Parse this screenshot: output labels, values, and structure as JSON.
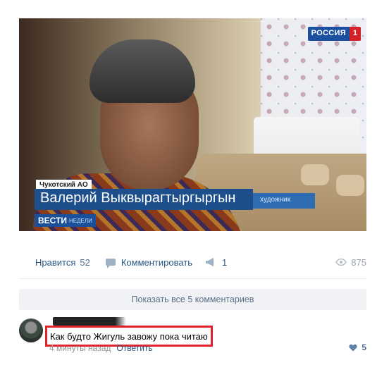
{
  "video": {
    "channel_logo": "РОССИЯ",
    "channel_number": "1",
    "region": "Чукотский АО",
    "person_name": "Валерий Выквырагтыргыргын",
    "person_role": "художник",
    "show_logo": "ВЕСТИ",
    "show_logo_sub": "НЕДЕЛИ"
  },
  "actions": {
    "like_label": "Нравится",
    "like_count": "52",
    "comment_label": "Комментировать",
    "share_count": "1",
    "views_count": "875"
  },
  "comments": {
    "show_all_label": "Показать все 5 комментариев",
    "items": [
      {
        "text": "Как будто Жигуль завожу пока читаю",
        "time": "4 минуты назад",
        "reply_label": "Ответить",
        "likes": "5"
      }
    ]
  },
  "colors": {
    "link": "#2a5885",
    "highlight_border": "#e2212a",
    "show_all_bg": "#f0f2f5"
  }
}
